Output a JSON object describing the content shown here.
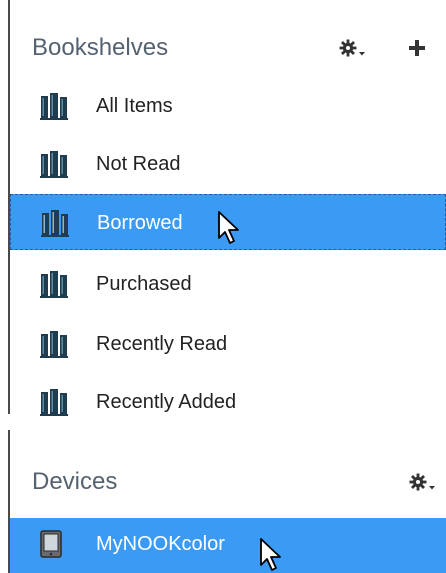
{
  "bookshelves": {
    "title": "Bookshelves",
    "settings_icon": "gear-dropdown-icon",
    "add_icon": "plus-icon",
    "items": [
      {
        "label": "All Items",
        "icon": "bookshelf-icon",
        "selected": false
      },
      {
        "label": "Not Read",
        "icon": "bookshelf-icon",
        "selected": false
      },
      {
        "label": "Borrowed",
        "icon": "bookshelf-icon",
        "selected": true
      },
      {
        "label": "Purchased",
        "icon": "bookshelf-icon",
        "selected": false
      },
      {
        "label": "Recently Read",
        "icon": "bookshelf-icon",
        "selected": false
      },
      {
        "label": "Recently Added",
        "icon": "bookshelf-icon",
        "selected": false
      }
    ]
  },
  "devices": {
    "title": "Devices",
    "settings_icon": "gear-dropdown-icon",
    "items": [
      {
        "label": "MyNOOKcolor",
        "icon": "tablet-icon",
        "selected": true
      }
    ]
  },
  "colors": {
    "selection": "#3b9bf4",
    "header_text": "#556270",
    "item_text": "#222222"
  }
}
